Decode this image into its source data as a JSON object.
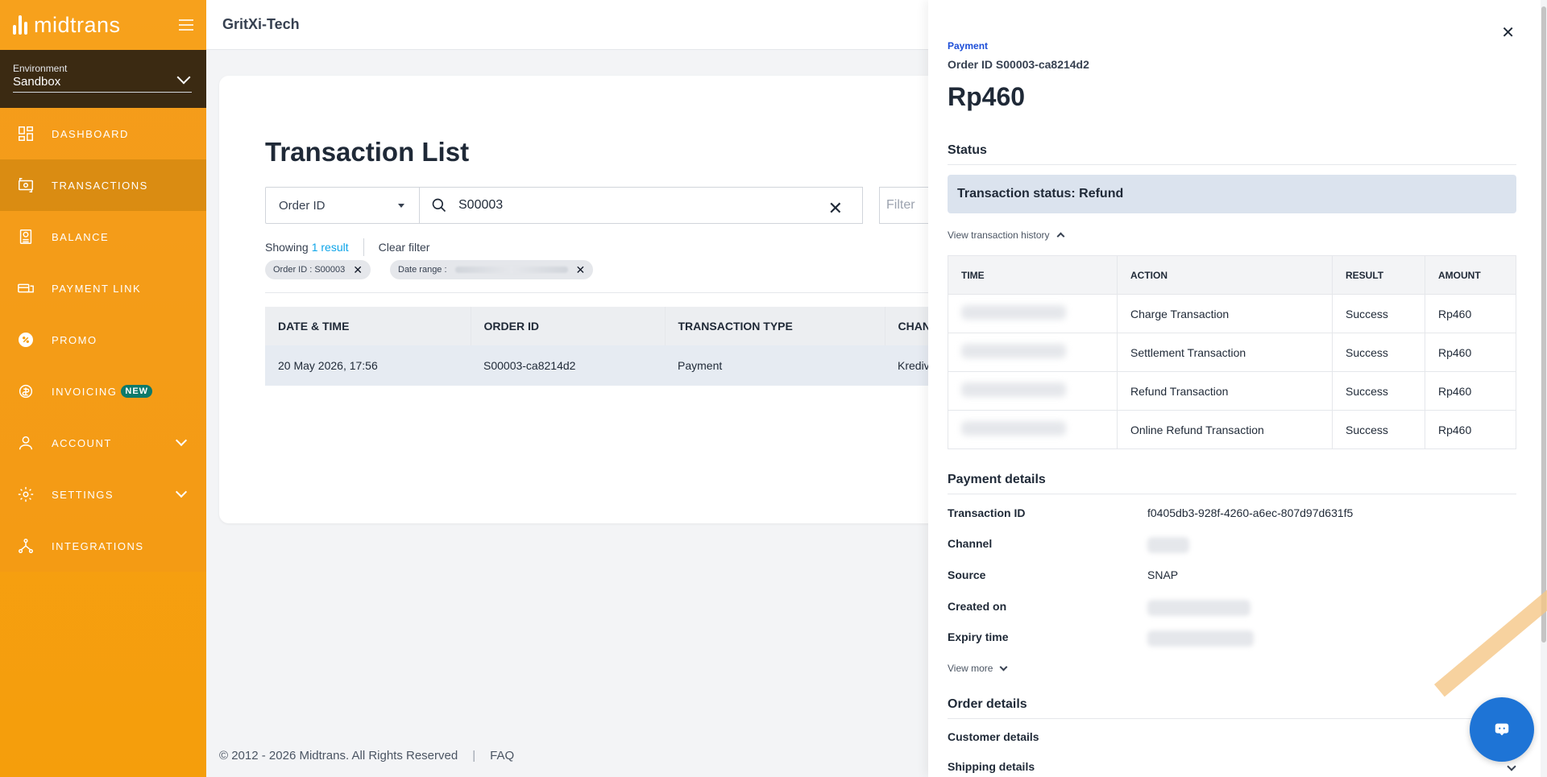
{
  "app": {
    "brand": "midtrans",
    "merchant": "GritXi-Tech"
  },
  "environment": {
    "label": "Environment",
    "value": "Sandbox"
  },
  "nav": {
    "dashboard": "DASHBOARD",
    "transactions": "TRANSACTIONS",
    "balance": "BALANCE",
    "payment_link": "PAYMENT LINK",
    "promo": "PROMO",
    "invoicing": "INVOICING",
    "invoicing_badge": "NEW",
    "account": "ACCOUNT",
    "settings": "SETTINGS",
    "integrations": "INTEGRATIONS"
  },
  "list": {
    "title": "Transaction List",
    "search_by": "Order ID",
    "search_value": "S00003",
    "filter_placeholder": "Filter",
    "showing_prefix": "Showing",
    "showing_count": "1 result",
    "clear_filter": "Clear filter",
    "chip_order": "Order ID : S00003",
    "chip_date": "Date range :",
    "columns": [
      "DATE & TIME",
      "ORDER ID",
      "TRANSACTION TYPE",
      "CHAN"
    ],
    "rows": [
      {
        "date": "20 May 2026, 17:56",
        "order_id": "S00003-ca8214d2",
        "type": "Payment",
        "channel": "Krediv"
      }
    ]
  },
  "footer": {
    "copyright": "© 2012 - 2026 Midtrans. All Rights Reserved",
    "sep": "|",
    "faq": "FAQ"
  },
  "detail": {
    "type": "Payment",
    "order_id": "Order ID S00003-ca8214d2",
    "amount": "Rp460",
    "status_heading": "Status",
    "status_text": "Transaction status: Refund",
    "history_link": "View transaction history",
    "history_columns": [
      "TIME",
      "ACTION",
      "RESULT",
      "AMOUNT"
    ],
    "history": [
      {
        "action": "Charge Transaction",
        "result": "Success",
        "amount": "Rp460"
      },
      {
        "action": "Settlement Transaction",
        "result": "Success",
        "amount": "Rp460"
      },
      {
        "action": "Refund Transaction",
        "result": "Success",
        "amount": "Rp460"
      },
      {
        "action": "Online Refund Transaction",
        "result": "Success",
        "amount": "Rp460"
      }
    ],
    "payment_heading": "Payment details",
    "transaction_id_label": "Transaction ID",
    "transaction_id": "f0405db3-928f-4260-a6ec-807d97d631f5",
    "channel_label": "Channel",
    "source_label": "Source",
    "source": "SNAP",
    "created_label": "Created on",
    "expiry_label": "Expiry time",
    "view_more": "View more",
    "order_heading": "Order details",
    "customer_label": "Customer details",
    "shipping_label": "Shipping details"
  },
  "colors": {
    "sidebar": "#f7a11c",
    "accent_blue": "#1e74d6",
    "link": "#0ea5e9"
  }
}
